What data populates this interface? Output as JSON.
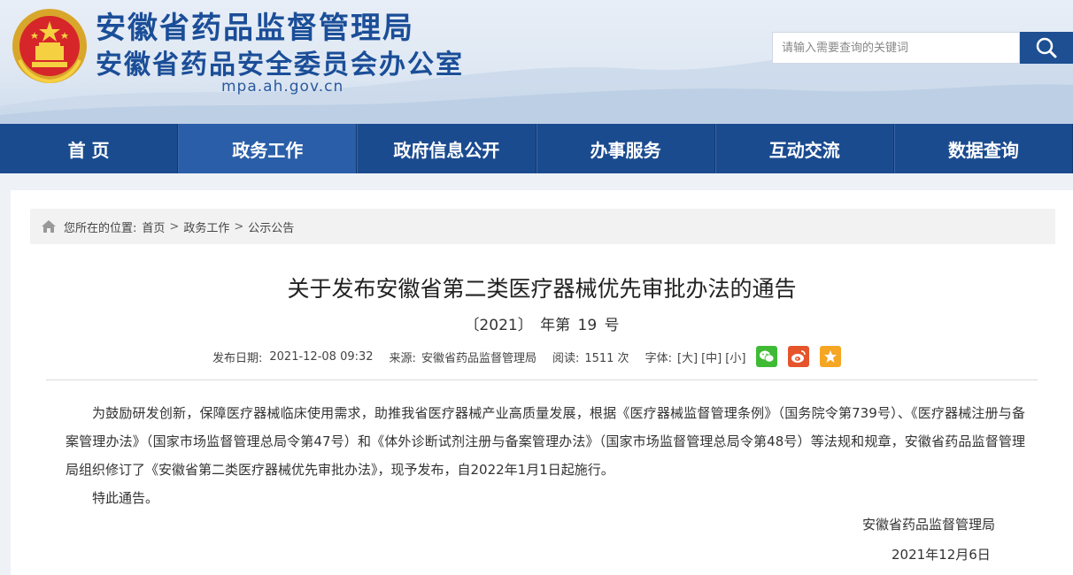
{
  "header": {
    "title_line1": "安徽省药品监督管理局",
    "title_line2": "安徽省药品安全委员会办公室",
    "domain": "mpa.ah.gov.cn",
    "emblem_icon": "national-emblem-icon"
  },
  "search": {
    "placeholder": "请输入需要查询的关键词",
    "button_icon": "search-icon"
  },
  "nav": {
    "items": [
      {
        "label": "首 页"
      },
      {
        "label": "政务工作"
      },
      {
        "label": "政府信息公开"
      },
      {
        "label": "办事服务"
      },
      {
        "label": "互动交流"
      },
      {
        "label": "数据查询"
      }
    ],
    "active_index": 1
  },
  "breadcrumb": {
    "prefix": "您所在的位置:",
    "items": [
      "首页",
      "政务工作",
      "公示公告"
    ],
    "separator": ">"
  },
  "article": {
    "title": "关于发布安徽省第二类医疗器械优先审批办法的通告",
    "doc_number": "〔2021〕 年第 19 号",
    "meta": {
      "publish_date_label": "发布日期:",
      "publish_date": "2021-12-08 09:32",
      "source_label": "来源:",
      "source": "安徽省药品监督管理局",
      "views_label": "阅读:",
      "views": "1511 次",
      "font_label": "字体:",
      "font_large": "[大]",
      "font_medium": "[中]",
      "font_small": "[小]"
    },
    "share": {
      "wechat_icon": "wechat-icon",
      "weibo_icon": "weibo-icon",
      "favorite_icon": "star-icon"
    },
    "paragraph1": "为鼓励研发创新，保障医疗器械临床使用需求，助推我省医疗器械产业高质量发展，根据《医疗器械监督管理条例》（国务院令第739号）、《医疗器械注册与备案管理办法》（国家市场监督管理总局令第47号）和《体外诊断试剂注册与备案管理办法》（国家市场监督管理总局令第48号）等法规和规章，安徽省药品监督管理局组织修订了《安徽省第二类医疗器械优先审批办法》，现予发布，自2022年1月1日起施行。",
    "paragraph2": "特此通告。",
    "signature_org": "安徽省药品监督管理局",
    "signature_date": "2021年12月6日"
  },
  "colors": {
    "brand_blue": "#1b4e98",
    "nav_bg": "#1b4b8f",
    "nav_active": "#2a5ea8",
    "wechat": "#3fba34",
    "weibo": "#e5542b",
    "favorite": "#f5a623"
  }
}
